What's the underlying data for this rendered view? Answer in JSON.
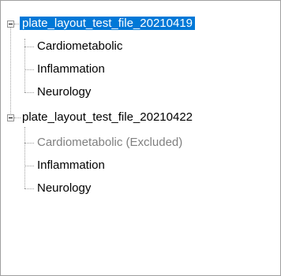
{
  "tree": {
    "roots": [
      {
        "label": "plate_layout_test_file_20210419",
        "expanded": true,
        "selected": true,
        "children": [
          {
            "label": "Cardiometabolic",
            "excluded": false
          },
          {
            "label": "Inflammation",
            "excluded": false
          },
          {
            "label": "Neurology",
            "excluded": false
          }
        ]
      },
      {
        "label": "plate_layout_test_file_20210422",
        "expanded": true,
        "selected": false,
        "children": [
          {
            "label": "Cardiometabolic (Excluded)",
            "excluded": true
          },
          {
            "label": "Inflammation",
            "excluded": false
          },
          {
            "label": "Neurology",
            "excluded": false
          }
        ]
      }
    ]
  },
  "colors": {
    "selection_background": "#0078d7",
    "selection_text": "#ffffff",
    "excluded_text": "#808080",
    "connector_lines": "#a0a0a0"
  }
}
